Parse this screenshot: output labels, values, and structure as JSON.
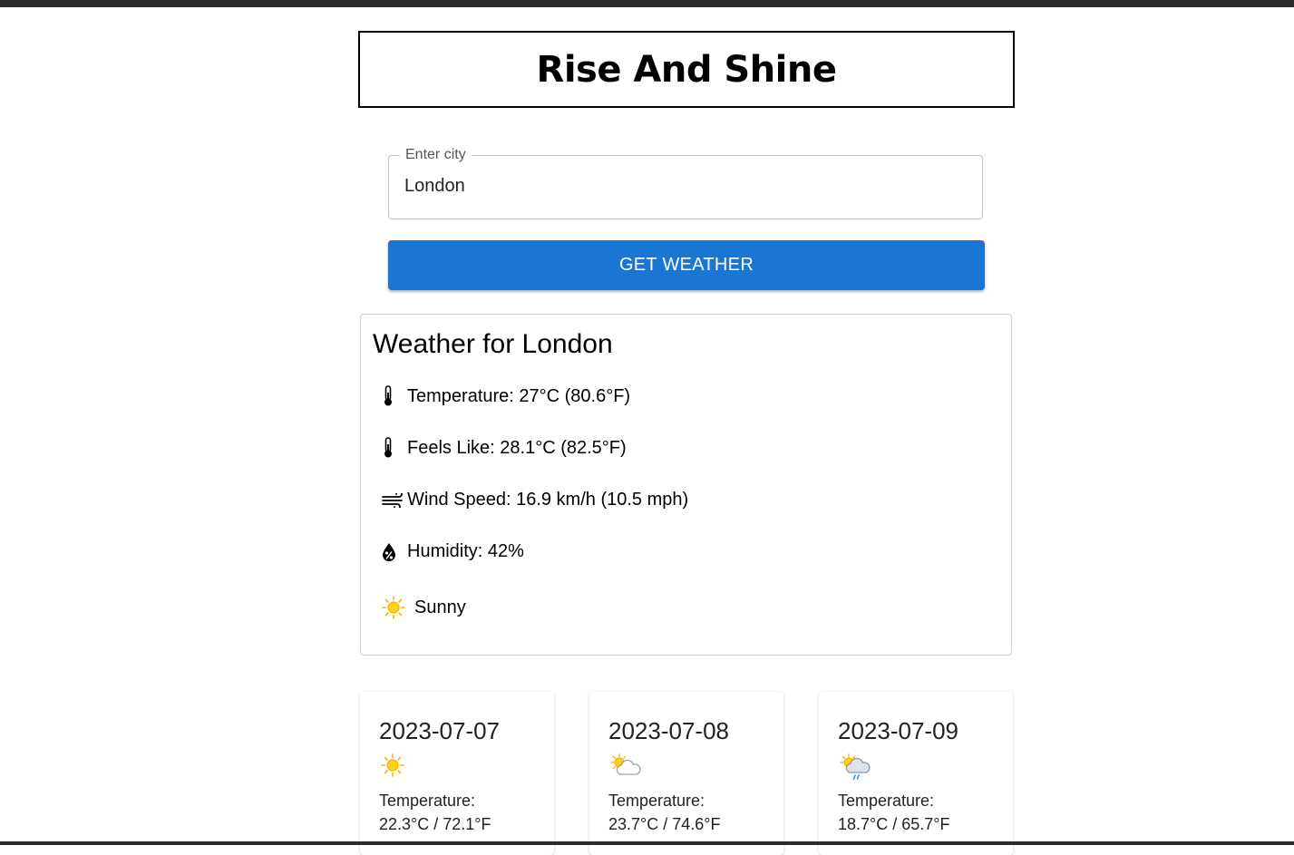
{
  "header": {
    "title": "Rise And Shine"
  },
  "search": {
    "label": "Enter city",
    "value": "London",
    "button_label": "GET WEATHER"
  },
  "current": {
    "heading": "Weather for London",
    "temperature": "Temperature: 27°C (80.6°F)",
    "feels_like": "Feels Like: 28.1°C (82.5°F)",
    "wind": "Wind Speed: 16.9 km/h (10.5 mph)",
    "humidity": "Humidity: 42%",
    "condition": "Sunny",
    "icons": {
      "temperature": "thermometer-icon",
      "feels_like": "thermometer-icon",
      "wind": "wind-icon",
      "humidity": "humidity-drop-icon",
      "condition": "sun-icon"
    }
  },
  "forecast": [
    {
      "date": "2023-07-07",
      "icon": "sun-icon",
      "temp_label": "Temperature:",
      "temp": "22.3°C / 72.1°F"
    },
    {
      "date": "2023-07-08",
      "icon": "sun-behind-cloud-icon",
      "temp_label": "Temperature:",
      "temp": "23.7°C / 74.6°F"
    },
    {
      "date": "2023-07-09",
      "icon": "sun-cloud-rain-icon",
      "temp_label": "Temperature:",
      "temp": "18.7°C / 65.7°F"
    }
  ],
  "colors": {
    "accent": "#1976d2",
    "sun": "#ffc21a",
    "chrome": "#2b2b2f"
  }
}
